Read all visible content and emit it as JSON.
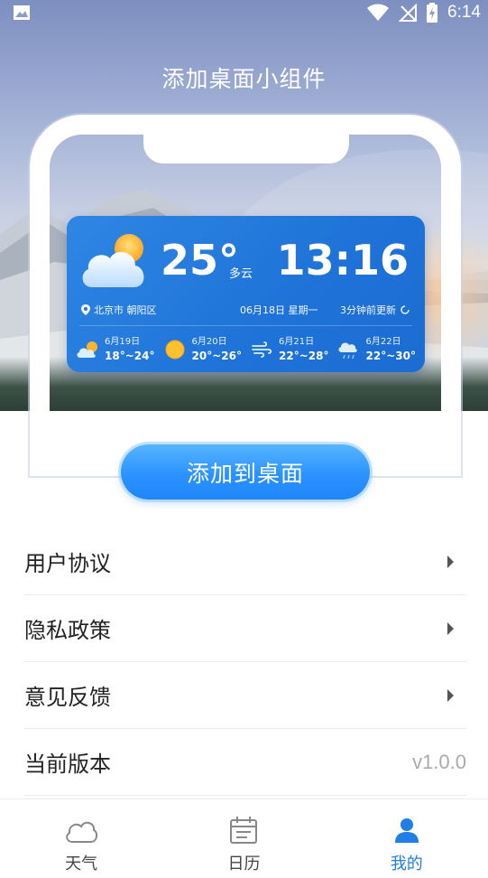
{
  "status_bar": {
    "time": "6:14"
  },
  "hero": {
    "title": "添加桌面小组件"
  },
  "widget": {
    "temperature": "25°",
    "condition": "多云",
    "clock": "13:16",
    "location": "北京市 朝阳区",
    "date": "06月18日 星期一",
    "updated": "3分钟前更新",
    "forecast": [
      {
        "date": "6月19日",
        "range": "18°~24°",
        "icon": "partly-cloudy-icon"
      },
      {
        "date": "6月20日",
        "range": "20°~26°",
        "icon": "sunny-icon"
      },
      {
        "date": "6月21日",
        "range": "22°~28°",
        "icon": "windy-icon"
      },
      {
        "date": "6月22日",
        "range": "22°~30°",
        "icon": "rain-icon"
      }
    ]
  },
  "add_button": {
    "label": "添加到桌面"
  },
  "menu": {
    "items": [
      {
        "label": "用户协议"
      },
      {
        "label": "隐私政策"
      },
      {
        "label": "意见反馈"
      },
      {
        "label": "当前版本",
        "value": "v1.0.0"
      }
    ]
  },
  "bottom_nav": {
    "items": [
      {
        "label": "天气",
        "icon": "cloud-icon"
      },
      {
        "label": "日历",
        "icon": "calendar-icon"
      },
      {
        "label": "我的",
        "icon": "user-icon",
        "active": true
      }
    ]
  },
  "colors": {
    "accent": "#1f7fe6",
    "widget_bg": "#1f73d8"
  }
}
